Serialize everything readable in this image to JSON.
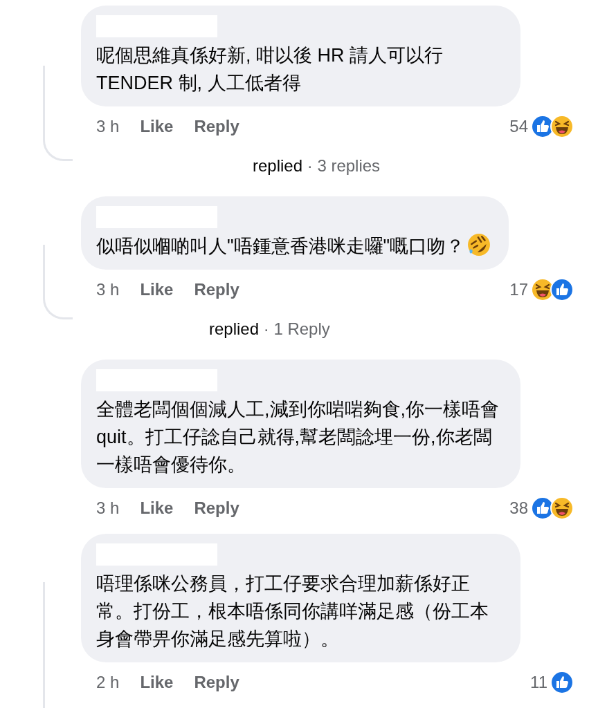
{
  "comments": [
    {
      "text": "呢個思維真係好新, 咁以後 HR 請人可以行 TENDER 制, 人工低者得",
      "time": "3 h",
      "like": "Like",
      "reply": "Reply",
      "reaction_count": "54",
      "reactions": [
        {
          "kind": "like"
        },
        {
          "kind": "haha"
        }
      ],
      "thread": {
        "kind": "curve"
      },
      "replies": {
        "label": "replied",
        "separator": "·",
        "count": "3 replies"
      }
    },
    {
      "text": "似唔似嗰啲叫人\"唔鍾意香港咪走囉\"嘅口吻？",
      "emoji": {
        "kind": "rofl"
      },
      "time": "3 h",
      "like": "Like",
      "reply": "Reply",
      "reaction_count": "17",
      "reactions": [
        {
          "kind": "haha"
        },
        {
          "kind": "like"
        }
      ],
      "thread": {
        "kind": "curve"
      },
      "replies": {
        "label": "replied",
        "separator": "·",
        "count": "1 Reply"
      }
    },
    {
      "text": "全體老闆個個減人工,減到你啱啱夠食,你一樣唔會quit。打工仔諗自己就得,幫老闆諗埋一份,你老闆一樣唔會優待你。",
      "time": "3 h",
      "like": "Like",
      "reply": "Reply",
      "reaction_count": "38",
      "reactions": [
        {
          "kind": "like"
        },
        {
          "kind": "haha"
        }
      ]
    },
    {
      "text": "唔理係咪公務員，打工仔要求合理加薪係好正常。打份工，根本唔係同你講咩滿足感（份工本身會帶畀你滿足感先算啦）。",
      "time": "2 h",
      "like": "Like",
      "reply": "Reply",
      "reaction_count": "11",
      "reactions": [
        {
          "kind": "like"
        }
      ],
      "thread": {
        "kind": "straight"
      }
    }
  ]
}
